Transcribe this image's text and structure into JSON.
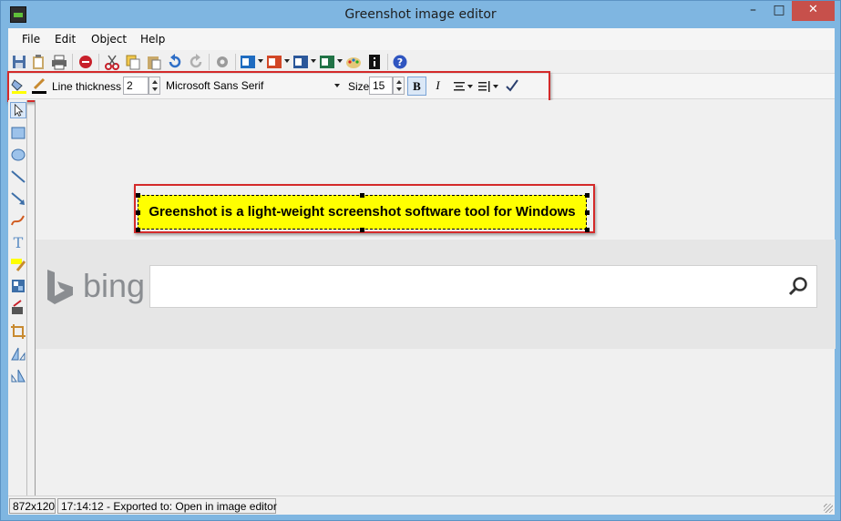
{
  "window": {
    "title": "Greenshot image editor",
    "min_glyph": "–",
    "max_glyph": "□",
    "close_glyph": "✕"
  },
  "menu": {
    "items": [
      "File",
      "Edit",
      "Object",
      "Help"
    ]
  },
  "toolbar": {
    "icons": [
      "save-icon",
      "clipboard-icon",
      "print-icon",
      "close-icon",
      "cut-icon",
      "copy-icon",
      "paste-icon",
      "undo-icon",
      "redo-icon",
      "settings-icon",
      "outlook-icon",
      "powerpoint-icon",
      "word-icon",
      "excel-icon",
      "paint-icon",
      "info-icon",
      "help-icon"
    ]
  },
  "properties": {
    "line_thickness_label": "Line thickness",
    "line_thickness_value": "2",
    "font_family": "Microsoft Sans Serif",
    "size_label": "Size",
    "size_value": "15",
    "bold_label": "B",
    "italic_label": "I"
  },
  "canvas": {
    "bing_text": "bing",
    "textbox_text": "Greenshot is a light-weight screenshot software tool for Windows"
  },
  "status": {
    "dimensions": "872x120",
    "message": "17:14:12 - Exported to: Open in image editor"
  },
  "colors": {
    "highlight": "#d42a2a",
    "text_fill": "#ffff00",
    "titlebar": "#7fb6e1",
    "close": "#c7504b"
  }
}
